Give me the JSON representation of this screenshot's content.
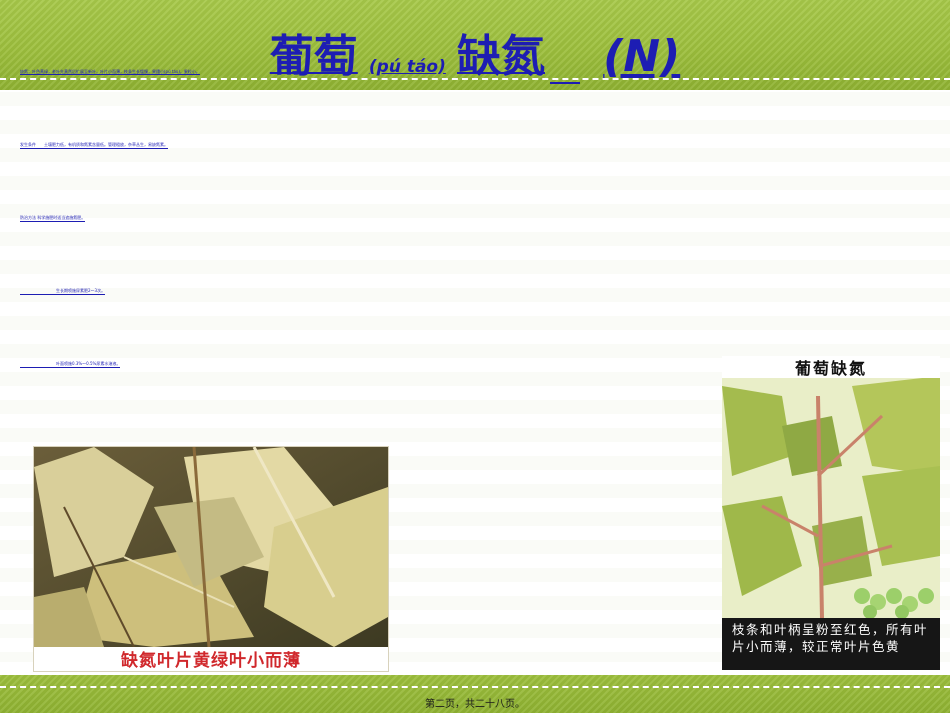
{
  "header": {
    "title_main": "葡萄",
    "title_pinyin": "(pú táo)",
    "title_deficiency": "缺氮",
    "title_element": "(N)",
    "subtitle": "缺氮：叶色黄绿，老叶先黄然后扩展至新叶，叶片小而薄，枝条生长缓慢，果穗小(pú táo)，果粒小。"
  },
  "content": {
    "bullet_glyph": "",
    "lines": [
      "发生条件　　土壤肥力低，有机质和氮素含量低。管理粗放，杂草丛生，易缺氮素。",
      "防治方法 科学施肥时适当追施氮肥。",
      "　　　　　　　　　生长期喷施尿素肥2～3次。",
      "　　　　　　　　　叶面喷施0.3%～0.5%尿素水溶液。"
    ]
  },
  "photos": {
    "left_caption": "缺氮叶片黄绿叶小而薄",
    "right_title": "葡萄缺氮",
    "right_caption": "枝条和叶柄呈粉至红色，所有叶片小而薄，较正常叶片色黄"
  },
  "footer": {
    "page_text": "第二页，共二十八页。"
  }
}
